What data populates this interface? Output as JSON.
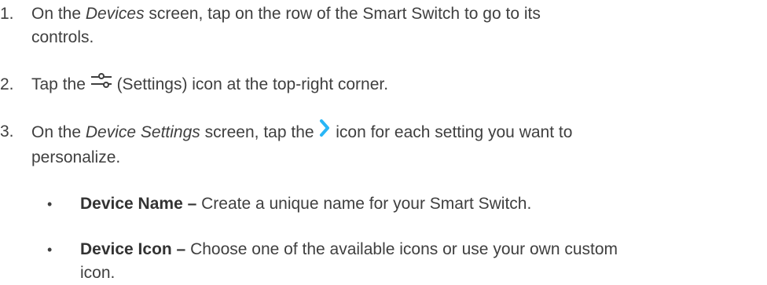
{
  "steps": [
    {
      "number": "1.",
      "part1": "On the ",
      "italic": "Devices",
      "part2": " screen, tap on the row of the Smart Switch to go to its",
      "part3": "controls."
    },
    {
      "number": "2.",
      "part1": "Tap the ",
      "icon": "settings-sliders-icon",
      "part2": " (Settings) icon at the top-right corner."
    },
    {
      "number": "3.",
      "part1": "On the ",
      "italic": "Device Settings",
      "part2": " screen, tap the ",
      "icon": "chevron-right-icon",
      "part3": " icon for each setting you want to",
      "part4": "personalize."
    }
  ],
  "bullets": [
    {
      "marker": "•",
      "title": "Device Name –",
      "text": " Create a unique name for your Smart Switch."
    },
    {
      "marker": "•",
      "title": "Device Icon –",
      "text": " Choose one of the available icons or use your own custom",
      "text2": "icon."
    }
  ],
  "colors": {
    "text": "#3f3f3f",
    "chevron": "#29b6f6",
    "settings_icon": "#3f3f3f"
  }
}
